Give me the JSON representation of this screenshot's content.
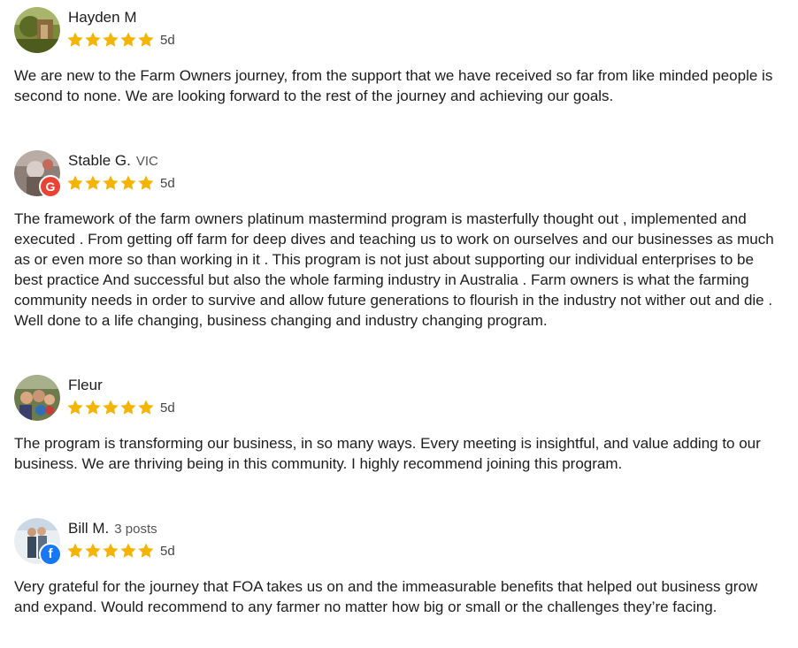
{
  "colors": {
    "star": "#f5b400",
    "google_badge": "#ea4335",
    "facebook_badge": "#1877f2",
    "text": "#1d1d1f",
    "meta": "#555555"
  },
  "reviews": [
    {
      "name": "Hayden M",
      "meta": "",
      "rating": 5,
      "age": "5d",
      "source_icon": "",
      "text": "We are new to the Farm Owners journey, from the support that we have received so far from like minded people is second to none. We are looking forward to the rest of the journey and achieving our goals."
    },
    {
      "name": "Stable G.",
      "meta": "VIC",
      "rating": 5,
      "age": "5d",
      "source_icon": "google-icon",
      "source_glyph": "G",
      "text": "The framework of the farm owners platinum mastermind program is masterfully thought out , implemented and executed . From getting off farm for deep dives and teaching us to work on ourselves and our businesses as much as or even more so than working in it . This program is not just about supporting our individual enterprises to be best practice And successful but also the whole farming industry in Australia . Farm owners is what the farming community needs in order to survive and allow future generations to flourish in the industry not wither out and die . Well done to a life changing, business changing and industry changing program."
    },
    {
      "name": "Fleur",
      "meta": "",
      "rating": 5,
      "age": "5d",
      "source_icon": "",
      "text": "The program is transforming our business, in so many ways. Every meeting is insightful, and value adding to our business. We are thriving being in this community. I highly recommend joining this program."
    },
    {
      "name": "Bill M.",
      "meta": "3 posts",
      "rating": 5,
      "age": "5d",
      "source_icon": "facebook-icon",
      "source_glyph": "f",
      "text": "Very grateful for the journey that FOA takes us on and the immeasurable benefits that helped out business grow and expand. Would recommend to any farmer no matter how big or small or the challenges they’re facing."
    }
  ]
}
